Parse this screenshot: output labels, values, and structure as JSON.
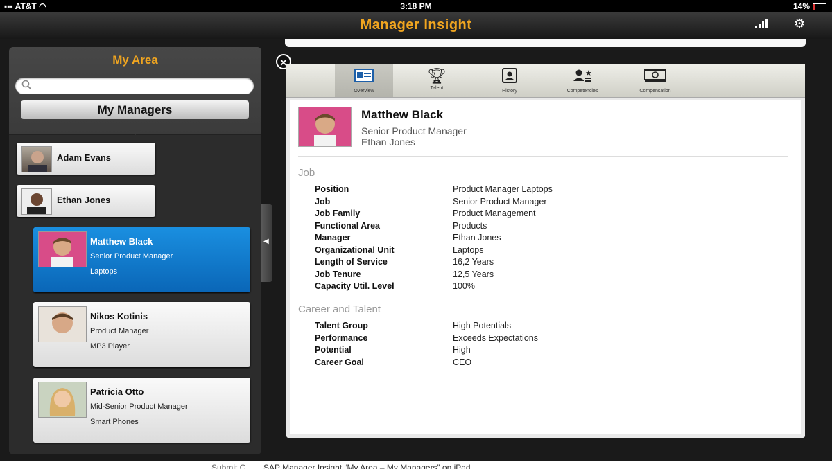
{
  "status": {
    "carrier": "AT&T",
    "time": "3:18 PM",
    "battery": "14%"
  },
  "app": {
    "title": "Manager Insight"
  },
  "left": {
    "area_title": "My Area",
    "search_placeholder": "",
    "my_managers_label": "My Managers",
    "managers": [
      {
        "name": "Adam Evans"
      },
      {
        "name": "Ethan Jones"
      }
    ],
    "reports": [
      {
        "name": "Matthew Black",
        "title": "Senior Product Manager",
        "unit": "Laptops",
        "selected": true
      },
      {
        "name": "Nikos Kotinis",
        "title": "Product Manager",
        "unit": "MP3 Player",
        "selected": false
      },
      {
        "name": "Patricia Otto",
        "title": "Mid-Senior Product Manager",
        "unit": "Smart Phones",
        "selected": false
      }
    ]
  },
  "tabs": [
    {
      "label": "Overview",
      "icon": "id-card-icon"
    },
    {
      "label": "Talent",
      "icon": "trophy-icon"
    },
    {
      "label": "History",
      "icon": "address-book-icon"
    },
    {
      "label": "Competencies",
      "icon": "person-star-icon"
    },
    {
      "label": "Compensation",
      "icon": "money-icon"
    }
  ],
  "profile": {
    "name": "Matthew Black",
    "title": "Senior Product Manager",
    "manager": "Ethan Jones"
  },
  "job": {
    "heading": "Job",
    "rows": [
      {
        "k": "Position",
        "v": "Product Manager Laptops"
      },
      {
        "k": "Job",
        "v": "Senior Product Manager"
      },
      {
        "k": "Job Family",
        "v": "Product Management"
      },
      {
        "k": "Functional Area",
        "v": "Products"
      },
      {
        "k": "Manager",
        "v": "Ethan Jones"
      },
      {
        "k": "Organizational Unit",
        "v": "Laptops"
      },
      {
        "k": "Length of Service",
        "v": "16,2 Years"
      },
      {
        "k": "Job Tenure",
        "v": "12,5 Years"
      },
      {
        "k": "Capacity Util. Level",
        "v": "100%"
      }
    ]
  },
  "career": {
    "heading": "Career and Talent",
    "rows": [
      {
        "k": "Talent Group",
        "v": "High Potentials"
      },
      {
        "k": "Performance",
        "v": "Exceeds Expectations"
      },
      {
        "k": "Potential",
        "v": "High"
      },
      {
        "k": "Career Goal",
        "v": "CEO"
      }
    ]
  },
  "caption": {
    "left": "Submit C",
    "text": "SAP Manager Insight “My Area – My Managers” on iPad"
  }
}
